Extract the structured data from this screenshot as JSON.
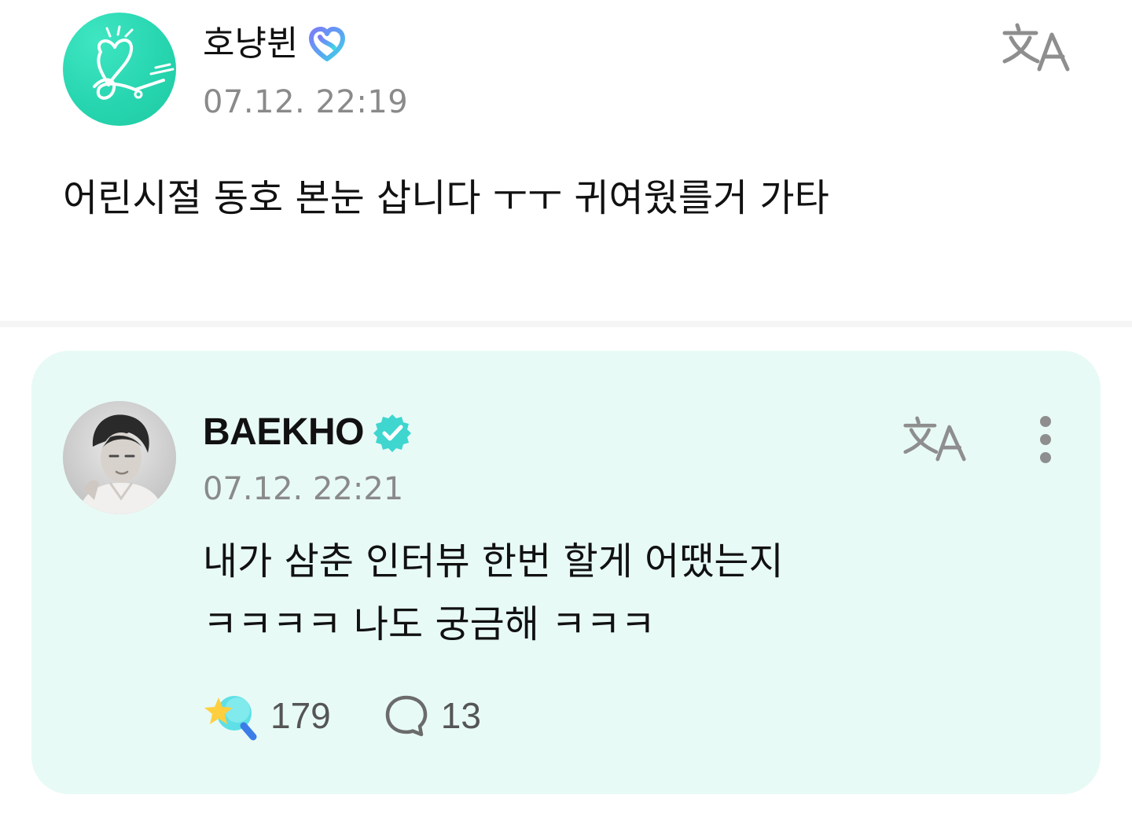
{
  "post": {
    "author": "호냥뷘",
    "timestamp": "07.12. 22:19",
    "body": "어린시절 동호 본눈 삽니다 ㅜㅜ 귀여웠를거 가타",
    "icons": {
      "badge": "fan-membership-badge-icon",
      "translate": "translate-icon"
    }
  },
  "reply": {
    "author": "BAEKHO",
    "timestamp": "07.12. 22:21",
    "body_lines": [
      "내가 삼춘 인터뷰 한번 할게 어땠는지",
      "ㅋㅋㅋㅋ 나도 궁금해 ㅋㅋㅋ"
    ],
    "likes": "179",
    "comments": "13",
    "icons": {
      "badge": "verified-badge-icon",
      "translate": "translate-icon",
      "more": "more-vertical-icon",
      "like": "star-wand-like-icon",
      "comment": "speech-bubble-icon"
    }
  },
  "colors": {
    "accent": "#27d6b0",
    "card_background": "#e8faf6",
    "verified": "#3ed6cf",
    "timestamp": "#8a8a8a",
    "count": "#555555"
  }
}
